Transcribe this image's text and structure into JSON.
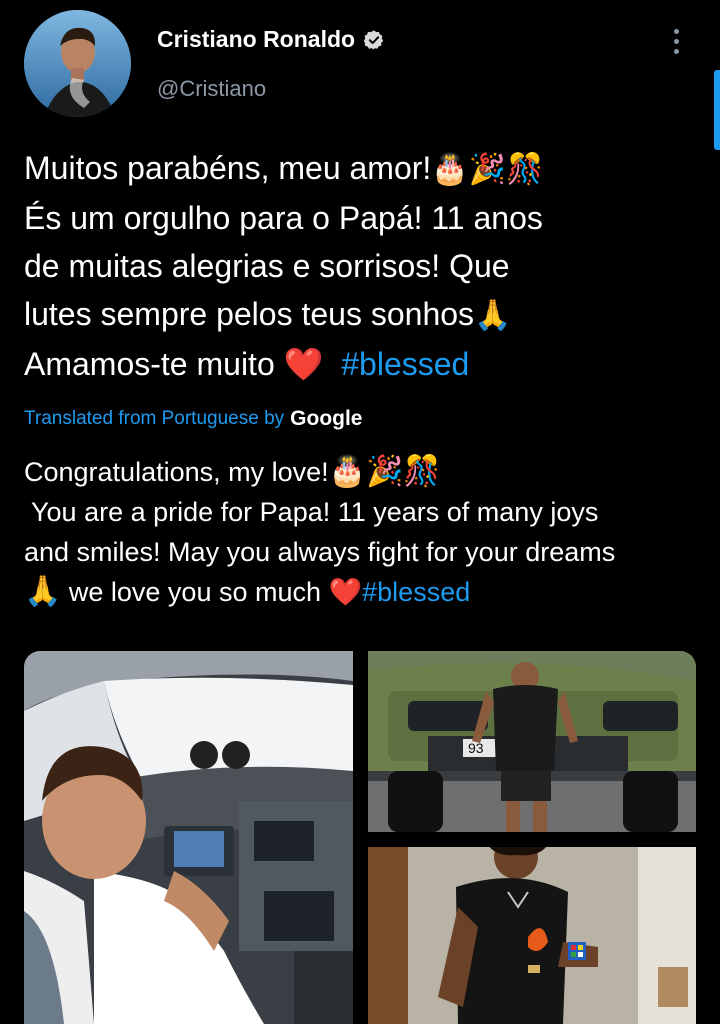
{
  "user": {
    "display_name": "Cristiano Ronaldo",
    "handle": "@Cristiano",
    "verified": true
  },
  "tweet": {
    "lines": [
      "Muitos parabéns, meu amor!",
      "És um orgulho para o Papá! 11 anos",
      "de muitas alegrias e sorrisos! Que",
      "lutes sempre pelos teus sonhos",
      "Amamos-te muito"
    ],
    "emoji_line1": "🎂🎉🎊",
    "emoji_line4": "🙏",
    "heart": "❤️",
    "hashtag": "#blessed"
  },
  "translation": {
    "label": "Translated from Portuguese by",
    "provider": "Google",
    "lines": [
      "Congratulations, my love!",
      " You are a pride for Papa! 11 years of many joys",
      "and smiles! May you always fight for your dreams",
      "we love you so much"
    ],
    "emoji_line1": "🎂🎉🎊",
    "emoji_line4": "🙏",
    "heart": "❤️",
    "hashtag": "#blessed"
  },
  "media": {
    "images": [
      {
        "name": "photo-cockpit"
      },
      {
        "name": "photo-truck",
        "plate_text": "93"
      },
      {
        "name": "photo-rubiks-cube"
      }
    ]
  },
  "colors": {
    "background": "#000000",
    "accent": "#1d9bf0",
    "secondary_text": "#8b98a5"
  }
}
